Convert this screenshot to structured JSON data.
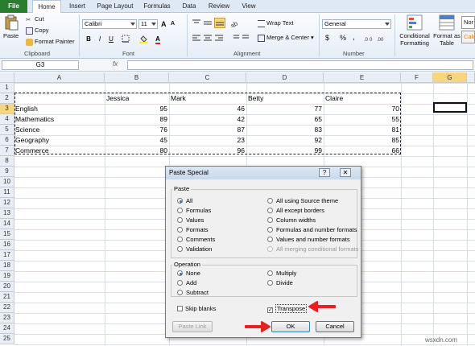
{
  "ribbon_tabs": [
    "File",
    "Home",
    "Insert",
    "Page Layout",
    "Formulas",
    "Data",
    "Review",
    "View"
  ],
  "clipboard": {
    "paste": "Paste",
    "cut": "Cut",
    "copy": "Copy",
    "format_painter": "Format Painter",
    "label": "Clipboard"
  },
  "font": {
    "name": "Calibri",
    "size": "11",
    "label": "Font",
    "bold": "B",
    "italic": "I",
    "underline": "U",
    "grow": "A",
    "shrink": "A"
  },
  "alignment": {
    "wrap_text": "Wrap Text",
    "merge_center": "Merge & Center",
    "label": "Alignment"
  },
  "number": {
    "format": "General",
    "currency": "$",
    "percent": "%",
    "comma": ",",
    "label": "Number"
  },
  "styles": {
    "conditional": "Conditional Formatting",
    "format_table": "Format as Table",
    "style_box": "Nor",
    "style_box2": "Calc"
  },
  "name_box": "G3",
  "fx": "fx",
  "columns": [
    "A",
    "B",
    "C",
    "D",
    "E",
    "F",
    "G"
  ],
  "rows": [
    "1",
    "2",
    "3",
    "4",
    "5",
    "6",
    "7",
    "8",
    "9",
    "10",
    "11",
    "12",
    "13",
    "14",
    "15",
    "16",
    "17",
    "18",
    "19",
    "20",
    "21",
    "22",
    "23",
    "24",
    "25"
  ],
  "sheet": {
    "headers": [
      "Jessica",
      "Mark",
      "Betty",
      "Claire"
    ],
    "data": [
      {
        "subject": "English",
        "values": [
          "95",
          "46",
          "77",
          "70"
        ]
      },
      {
        "subject": "Mathematics",
        "values": [
          "89",
          "42",
          "65",
          "55"
        ]
      },
      {
        "subject": "Science",
        "values": [
          "76",
          "87",
          "83",
          "81"
        ]
      },
      {
        "subject": "Geography",
        "values": [
          "45",
          "23",
          "92",
          "85"
        ]
      },
      {
        "subject": "Commerce",
        "values": [
          "80",
          "96",
          "99",
          "66"
        ]
      }
    ]
  },
  "dialog": {
    "title": "Paste Special",
    "help": "?",
    "close": "✕",
    "paste_legend": "Paste",
    "paste_left": [
      "All",
      "Formulas",
      "Values",
      "Formats",
      "Comments",
      "Validation"
    ],
    "paste_right": [
      "All using Source theme",
      "All except borders",
      "Column widths",
      "Formulas and number formats",
      "Values and number formats",
      "All merging conditional formats"
    ],
    "operation_legend": "Operation",
    "op_left": [
      "None",
      "Add",
      "Subtract"
    ],
    "op_right": [
      "Multiply",
      "Divide"
    ],
    "skip_blanks": "Skip blanks",
    "transpose": "Transpose",
    "paste_link": "Paste Link",
    "ok": "OK",
    "cancel": "Cancel"
  },
  "watermark": "wsxdn.com",
  "colors": {
    "file_tab": "#2a7d2e",
    "arrow": "#e8201f",
    "selected_header": "#f8d680"
  }
}
